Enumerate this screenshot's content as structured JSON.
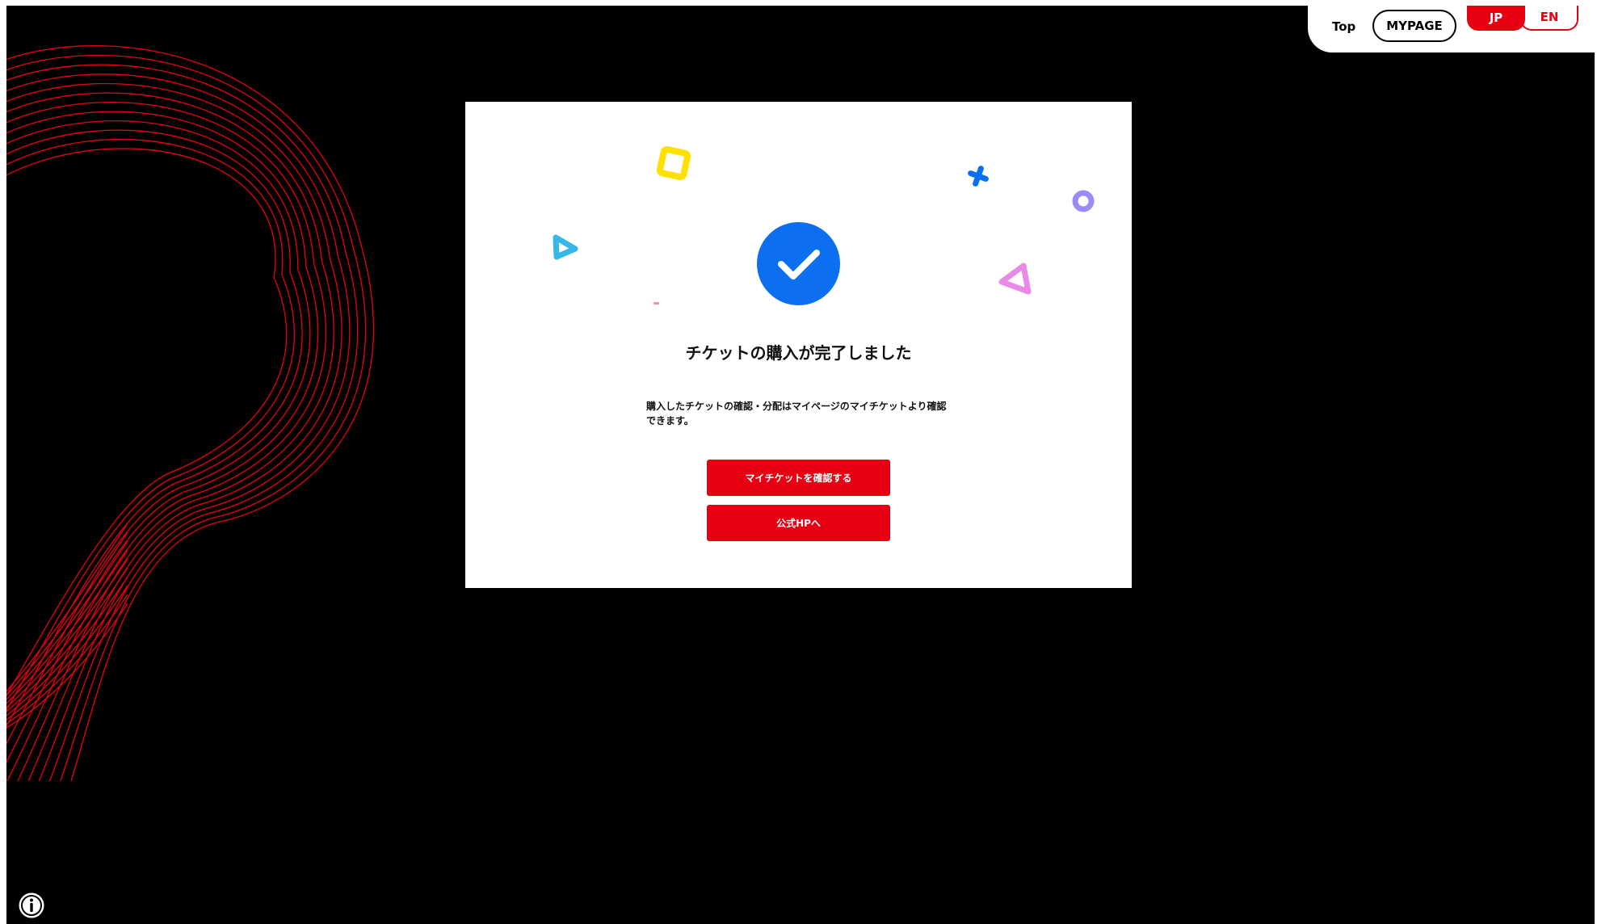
{
  "header": {
    "top_label": "Top",
    "mypage_label": "MYPAGE",
    "lang_jp_label": "JP",
    "lang_en_label": "EN",
    "active_lang": "JP"
  },
  "modal": {
    "title": "チケットの購入が完了しました",
    "message": "購入したチケットの確認・分配はマイページのマイチケットより確認できます。",
    "myticket_button_label": "マイチケットを確認する",
    "official_button_label": "公式HPへ",
    "status_icon": "check-circle-icon"
  },
  "colors": {
    "page_background": "#000000",
    "accent_red": "#e60012",
    "check_blue": "#0b6ff0",
    "deco_yellow": "#ffe000",
    "deco_blue": "#0b6ff0",
    "deco_purple": "#9b8cf5",
    "deco_cyan": "#35b7e8",
    "deco_pink": "#e98ae8"
  },
  "footer": {
    "info_icon": "info-icon"
  }
}
